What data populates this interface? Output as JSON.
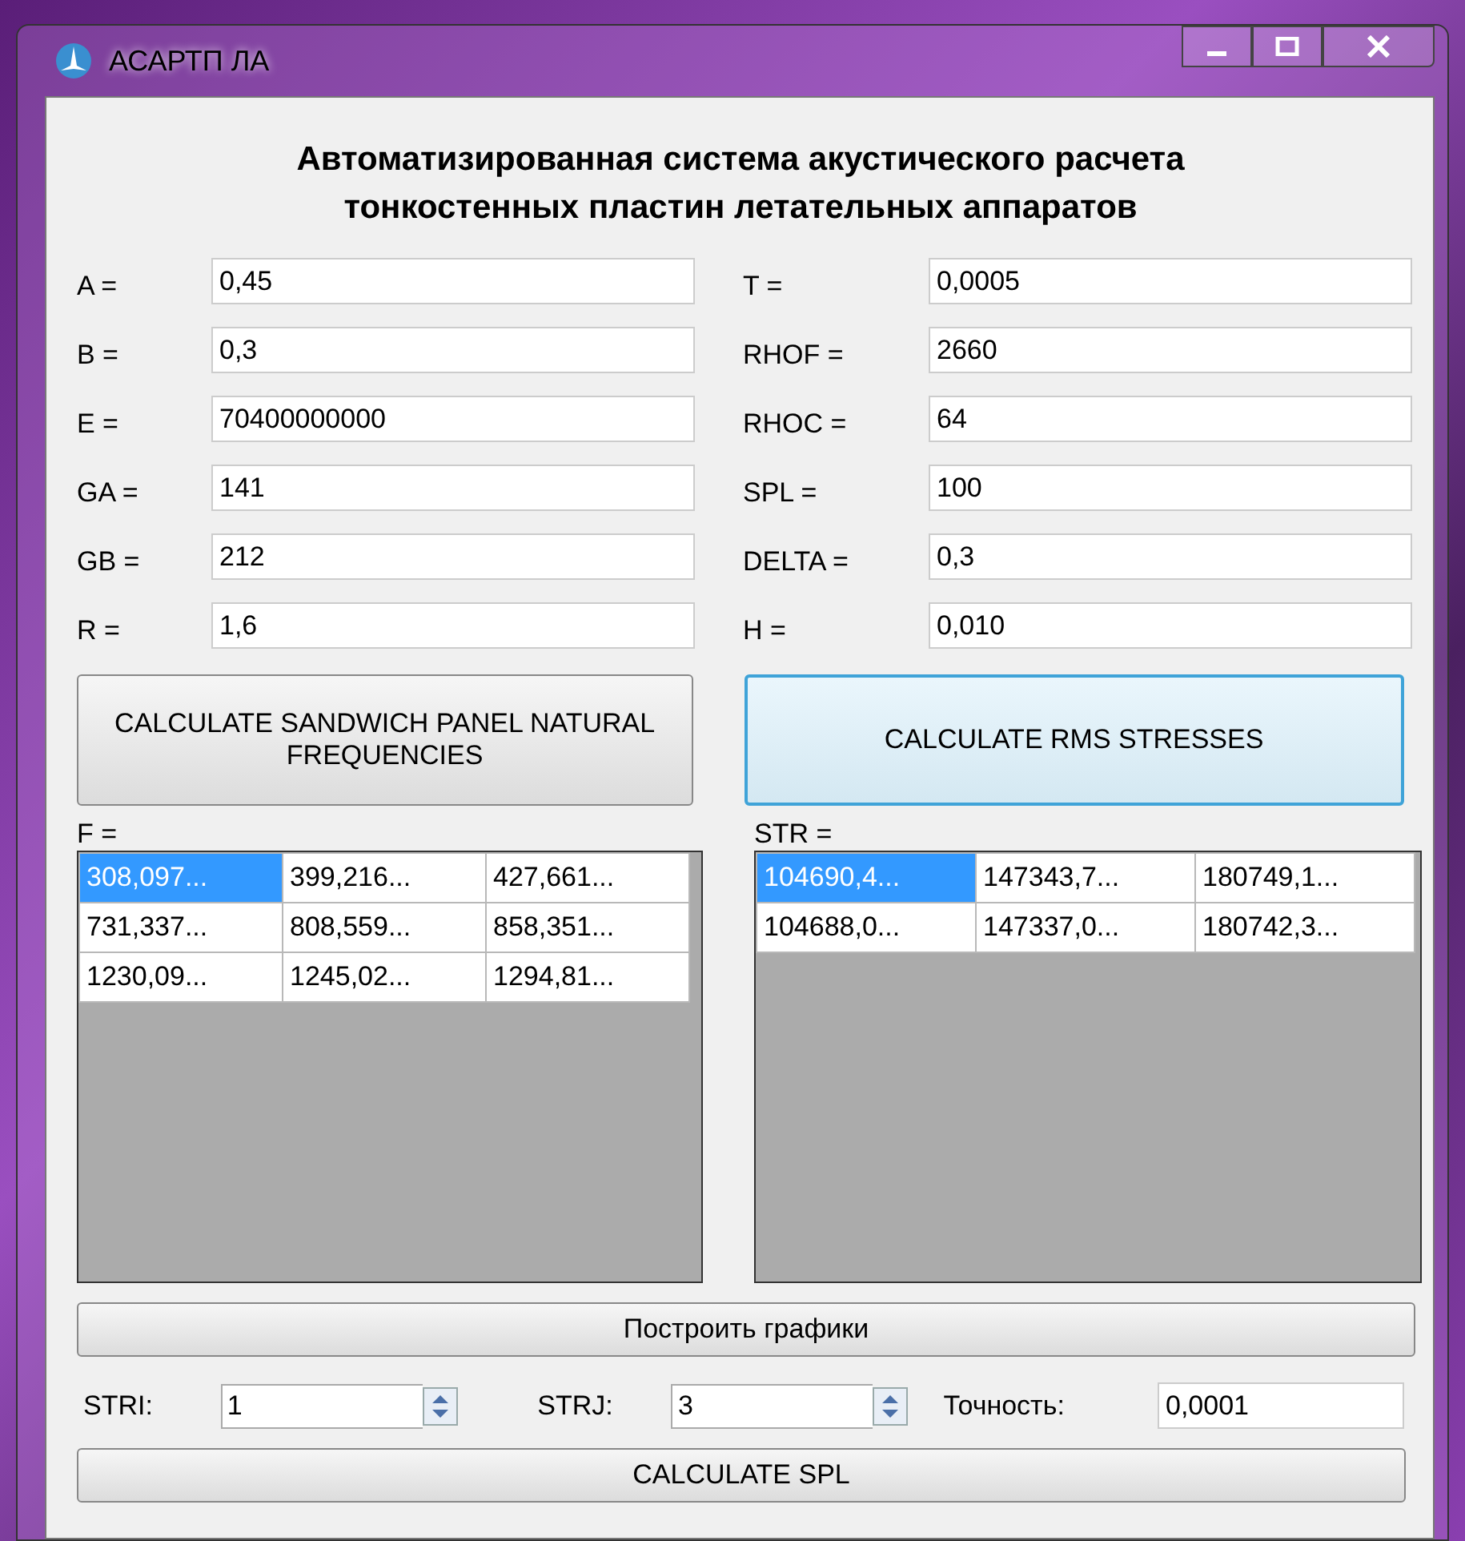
{
  "window": {
    "title": "АСАРТП ЛА"
  },
  "heading": "Автоматизированная система акустического расчета тонкостенных пластин летательных аппаратов",
  "left_fields": [
    {
      "label": "A =",
      "value": "0,45"
    },
    {
      "label": "B =",
      "value": "0,3"
    },
    {
      "label": "E =",
      "value": "70400000000"
    },
    {
      "label": "GA =",
      "value": "141"
    },
    {
      "label": "GB =",
      "value": "212"
    },
    {
      "label": "R =",
      "value": "1,6"
    }
  ],
  "right_fields": [
    {
      "label": "T =",
      "value": "0,0005"
    },
    {
      "label": "RHOF =",
      "value": "2660"
    },
    {
      "label": "RHOC =",
      "value": "64"
    },
    {
      "label": "SPL =",
      "value": "100"
    },
    {
      "label": "DELTA =",
      "value": "0,3"
    },
    {
      "label": "H =",
      "value": "0,010"
    }
  ],
  "buttons": [
    {
      "label": "CALCULATE SANDWICH PANEL NATURAL FREQUENCIES",
      "focused": false
    },
    {
      "label": "CALCULATE RMS STRESSES",
      "focused": true
    }
  ],
  "grids": [
    {
      "label": "F =",
      "rows": [
        [
          {
            "text": "308,097...",
            "selected": true
          },
          {
            "text": "399,216...",
            "selected": false
          },
          {
            "text": "427,661...",
            "selected": false
          }
        ],
        [
          {
            "text": "731,337...",
            "selected": false
          },
          {
            "text": "808,559...",
            "selected": false
          },
          {
            "text": "858,351...",
            "selected": false
          }
        ],
        [
          {
            "text": "1230,09...",
            "selected": false
          },
          {
            "text": "1245,02...",
            "selected": false
          },
          {
            "text": "1294,81...",
            "selected": false
          }
        ]
      ]
    },
    {
      "label": "STR =",
      "rows": [
        [
          {
            "text": "104690,4...",
            "selected": true
          },
          {
            "text": "147343,7...",
            "selected": false
          },
          {
            "text": "180749,1...",
            "selected": false
          }
        ],
        [
          {
            "text": "104688,0...",
            "selected": false
          },
          {
            "text": "147337,0...",
            "selected": false
          },
          {
            "text": "180742,3...",
            "selected": false
          }
        ]
      ]
    }
  ],
  "plot_button": "Построить графики",
  "stri": {
    "label": "STRI:",
    "value": "1"
  },
  "strj": {
    "label": "STRJ:",
    "value": "3"
  },
  "accuracy": {
    "label": "Точность:",
    "value": "0,0001"
  },
  "spl_button": "CALCULATE SPL"
}
